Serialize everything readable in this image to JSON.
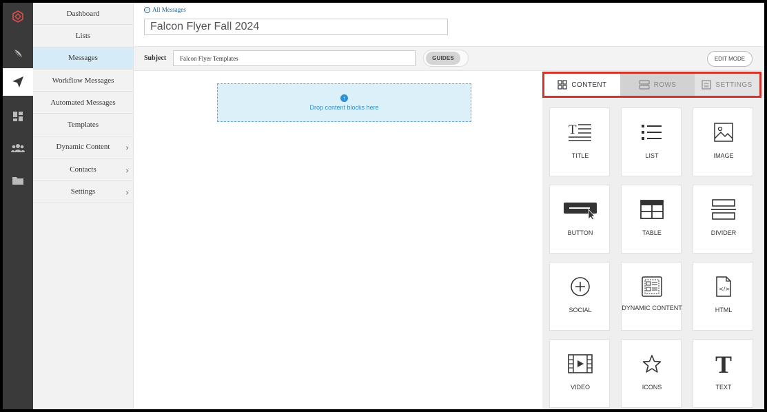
{
  "rail": {
    "icons": [
      "logo-icon",
      "feather-icon",
      "send-icon",
      "dashboard-icon",
      "users-icon",
      "folder-icon"
    ]
  },
  "nav": {
    "items": [
      {
        "label": "Dashboard"
      },
      {
        "label": "Lists"
      },
      {
        "label": "Messages"
      },
      {
        "label": "Workflow Messages"
      },
      {
        "label": "Automated Messages"
      },
      {
        "label": "Templates"
      },
      {
        "label": "Dynamic Content",
        "chevron": "›"
      },
      {
        "label": "Contacts",
        "chevron": "›"
      },
      {
        "label": "Settings",
        "chevron": "›"
      }
    ]
  },
  "header": {
    "back_label": "All Messages",
    "back_icon": "←",
    "title_value": "Falcon Flyer Fall 2024"
  },
  "subject": {
    "label": "Subject",
    "value": "Falcon Flyer Templates",
    "guides_label": "GUIDES",
    "edit_mode_label": "EDIT MODE"
  },
  "canvas": {
    "drop_icon": "↑",
    "drop_text": "Drop content blocks here"
  },
  "panel": {
    "tabs": [
      {
        "label": "CONTENT"
      },
      {
        "label": "ROWS"
      },
      {
        "label": "SETTINGS"
      }
    ],
    "blocks": [
      {
        "label": "TITLE"
      },
      {
        "label": "LIST"
      },
      {
        "label": "IMAGE"
      },
      {
        "label": "BUTTON"
      },
      {
        "label": "TABLE"
      },
      {
        "label": "DIVIDER"
      },
      {
        "label": "SOCIAL"
      },
      {
        "label": "DYNAMIC CONTENT"
      },
      {
        "label": "HTML"
      },
      {
        "label": "VIDEO"
      },
      {
        "label": "ICONS"
      },
      {
        "label": "TEXT"
      }
    ]
  },
  "colors": {
    "rail": "#3a3a3a",
    "active_nav": "#d5ebf7",
    "drop_zone": "#dcf0fa",
    "accent": "#2f8fd0",
    "highlight": "#d0342c"
  }
}
